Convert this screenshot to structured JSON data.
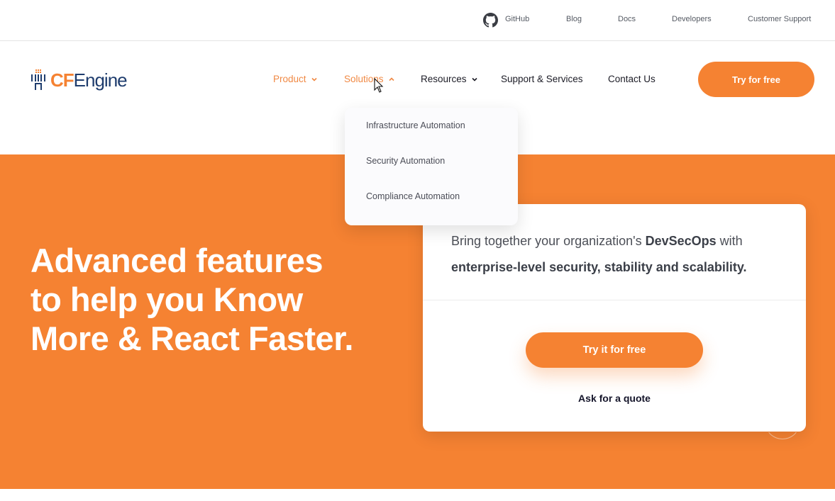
{
  "topbar": {
    "links": [
      {
        "label": "GitHub",
        "icon": "github-icon"
      },
      {
        "label": "Blog"
      },
      {
        "label": "Docs"
      },
      {
        "label": "Developers"
      },
      {
        "label": "Customer Support"
      }
    ]
  },
  "logo": {
    "cf": "CF",
    "engine": "Engine"
  },
  "nav": {
    "items": [
      {
        "label": "Product",
        "has_dropdown": true,
        "state": "collapsed"
      },
      {
        "label": "Solutions",
        "has_dropdown": true,
        "state": "expanded"
      },
      {
        "label": "Resources",
        "has_dropdown": true,
        "state": "collapsed"
      },
      {
        "label": "Support & Services"
      },
      {
        "label": "Contact Us"
      }
    ],
    "cta_label": "Try for free"
  },
  "solutions_menu": {
    "items": [
      {
        "label": "Infrastructure Automation"
      },
      {
        "label": "Security Automation"
      },
      {
        "label": "Compliance Automation"
      }
    ]
  },
  "hero": {
    "title": "Advanced features to help you Know More & React Faster.",
    "card": {
      "text_part1": "Bring together your organization's ",
      "text_bold1": "DevSecOps",
      "text_part2": " with ",
      "text_bold2": "enterprise-level security, stability and scalability.",
      "cta_label": "Try it for free",
      "quote_label": "Ask for a quote"
    }
  },
  "colors": {
    "brand_orange": "#f58232",
    "brand_navy": "#1f3d6e",
    "text_dark": "#1b1b25"
  }
}
